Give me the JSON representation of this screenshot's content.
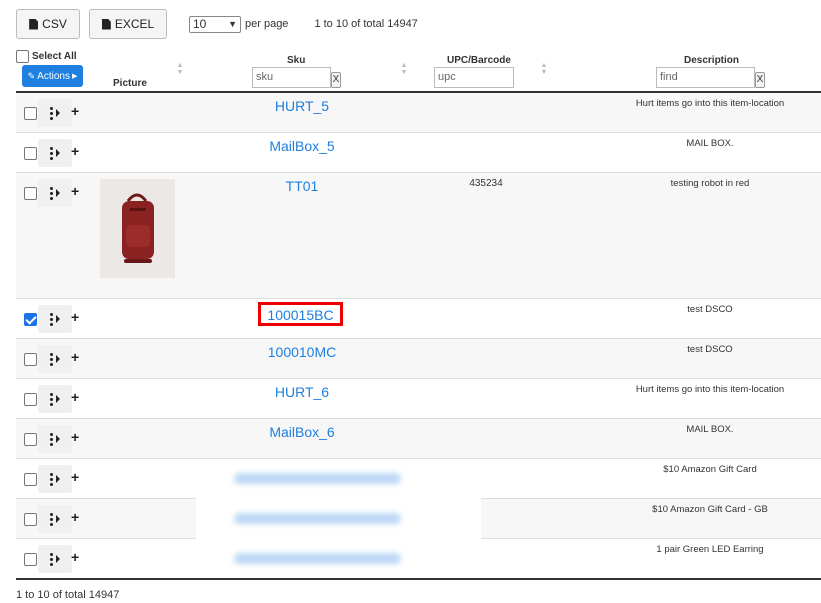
{
  "toolbar": {
    "csv_label": "CSV",
    "excel_label": "EXCEL",
    "per_page_value": "10",
    "per_page_label": "per page",
    "range_text": "1 to 10 of total 14947"
  },
  "header": {
    "select_all": "Select All",
    "actions": "Actions",
    "picture": "Picture",
    "sku": "Sku",
    "upc": "UPC/Barcode",
    "description": "Description",
    "sku_filter_value": "sku",
    "upc_filter_value": "upc",
    "desc_filter_value": "find",
    "clear_label": "X"
  },
  "rows": [
    {
      "sku": "HURT_5",
      "upc": "",
      "description": "Hurt items go into this item-location",
      "checked": false
    },
    {
      "sku": "MailBox_5",
      "upc": "",
      "description": "MAIL BOX.",
      "checked": false
    },
    {
      "sku": "TT01",
      "upc": "435234",
      "description": "testing robot in red",
      "checked": false,
      "has_picture": true
    },
    {
      "sku": "100015BC",
      "upc": "",
      "description": "test DSCO",
      "checked": true,
      "highlighted": true
    },
    {
      "sku": "100010MC",
      "upc": "",
      "description": "test DSCO",
      "checked": false
    },
    {
      "sku": "HURT_6",
      "upc": "",
      "description": "Hurt items go into this item-location",
      "checked": false
    },
    {
      "sku": "MailBox_6",
      "upc": "",
      "description": "MAIL BOX.",
      "checked": false
    },
    {
      "sku": "",
      "upc": "",
      "description": "$10 Amazon Gift Card",
      "checked": false,
      "blurred": true
    },
    {
      "sku": "",
      "upc": "",
      "description": "$10 Amazon Gift Card - GB",
      "checked": false,
      "blurred": true
    },
    {
      "sku": "",
      "upc": "",
      "description": "1 pair Green LED Earring",
      "checked": false,
      "blurred": true
    }
  ],
  "footer": {
    "range_text": "1 to 10 of total 14947"
  },
  "colors": {
    "link": "#1e7fe0",
    "actions_bg": "#1e7fe0",
    "highlight": "#e00000",
    "checkbox_checked": "#1a73e8"
  },
  "icons": {
    "export": "file-icon",
    "row_menu": "kebab-icon",
    "expand": "plus-icon",
    "sort": "sort-icon"
  }
}
